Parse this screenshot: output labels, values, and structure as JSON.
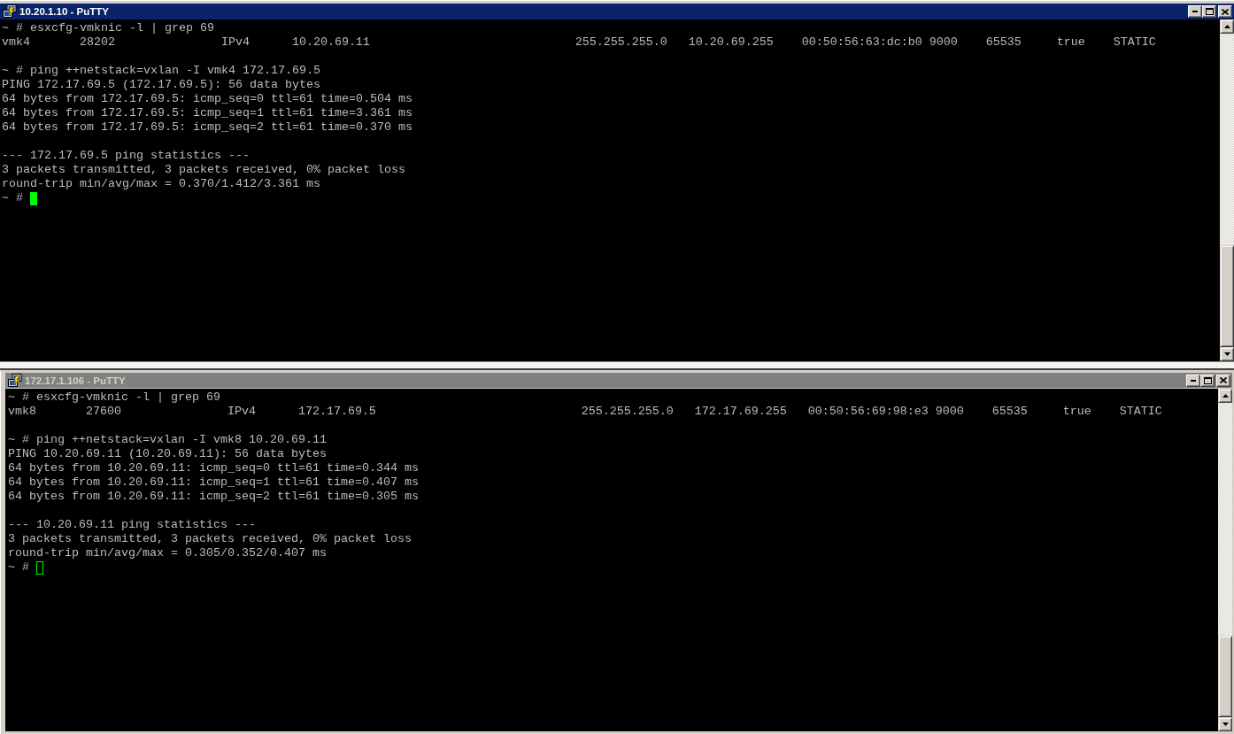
{
  "windows": [
    {
      "title": "10.20.1.10 - PuTTY",
      "active": true,
      "lines": [
        {
          "kind": "text",
          "text": "~ # esxcfg-vmknic -l | grep 69"
        },
        {
          "kind": "fields",
          "fields": [
            "vmk4",
            "28202",
            "IPv4",
            "10.20.69.11",
            "255.255.255.0",
            "10.20.69.255",
            "00:50:56:63:dc:b0",
            "9000",
            "65535",
            "true",
            "STATIC"
          ]
        },
        {
          "kind": "blank"
        },
        {
          "kind": "text",
          "text": "~ # ping ++netstack=vxlan -I vmk4 172.17.69.5"
        },
        {
          "kind": "text",
          "text": "PING 172.17.69.5 (172.17.69.5): 56 data bytes"
        },
        {
          "kind": "text",
          "text": "64 bytes from 172.17.69.5: icmp_seq=0 ttl=61 time=0.504 ms"
        },
        {
          "kind": "text",
          "text": "64 bytes from 172.17.69.5: icmp_seq=1 ttl=61 time=3.361 ms"
        },
        {
          "kind": "text",
          "text": "64 bytes from 172.17.69.5: icmp_seq=2 ttl=61 time=0.370 ms"
        },
        {
          "kind": "blank"
        },
        {
          "kind": "text",
          "text": "--- 172.17.69.5 ping statistics ---"
        },
        {
          "kind": "text",
          "text": "3 packets transmitted, 3 packets received, 0% packet loss"
        },
        {
          "kind": "text",
          "text": "round-trip min/avg/max = 0.370/1.412/3.361 ms"
        },
        {
          "kind": "prompt",
          "text": "~ #"
        }
      ]
    },
    {
      "title": "172.17.1.106 - PuTTY",
      "active": false,
      "lines": [
        {
          "kind": "text",
          "text": "~ # esxcfg-vmknic -l | grep 69"
        },
        {
          "kind": "fields",
          "fields": [
            "vmk8",
            "27600",
            "IPv4",
            "172.17.69.5",
            "255.255.255.0",
            "172.17.69.255",
            "00:50:56:69:98:e3",
            "9000",
            "65535",
            "true",
            "STATIC"
          ]
        },
        {
          "kind": "blank"
        },
        {
          "kind": "text",
          "text": "~ # ping ++netstack=vxlan -I vmk8 10.20.69.11"
        },
        {
          "kind": "text",
          "text": "PING 10.20.69.11 (10.20.69.11): 56 data bytes"
        },
        {
          "kind": "text",
          "text": "64 bytes from 10.20.69.11: icmp_seq=0 ttl=61 time=0.344 ms"
        },
        {
          "kind": "text",
          "text": "64 bytes from 10.20.69.11: icmp_seq=1 ttl=61 time=0.407 ms"
        },
        {
          "kind": "text",
          "text": "64 bytes from 10.20.69.11: icmp_seq=2 ttl=61 time=0.305 ms"
        },
        {
          "kind": "blank"
        },
        {
          "kind": "text",
          "text": "--- 10.20.69.11 ping statistics ---"
        },
        {
          "kind": "text",
          "text": "3 packets transmitted, 3 packets received, 0% packet loss"
        },
        {
          "kind": "text",
          "text": "round-trip min/avg/max = 0.305/0.352/0.407 ms"
        },
        {
          "kind": "prompt",
          "text": "~ #"
        }
      ]
    }
  ]
}
